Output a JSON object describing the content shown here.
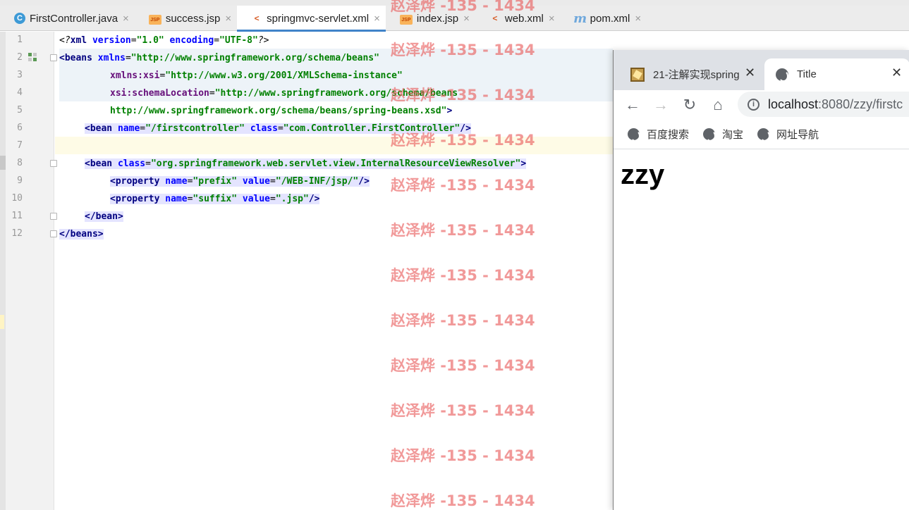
{
  "editor_tabs": [
    {
      "label": "FirstController.java",
      "icon": "java-class-icon",
      "icon_text": "C"
    },
    {
      "label": "success.jsp",
      "icon": "jsp-file-icon",
      "icon_text": "JSP"
    },
    {
      "label": "springmvc-servlet.xml",
      "icon": "xml-file-icon",
      "icon_text": "<"
    },
    {
      "label": "index.jsp",
      "icon": "jsp-file-icon",
      "icon_text": "JSP"
    },
    {
      "label": "web.xml",
      "icon": "xml-file-icon",
      "icon_text": "<"
    },
    {
      "label": "pom.xml",
      "icon": "maven-icon",
      "icon_text": "m"
    }
  ],
  "tab_close_glyph": "×",
  "line_numbers": [
    "1",
    "2",
    "3",
    "4",
    "5",
    "6",
    "7",
    "8",
    "9",
    "10",
    "11",
    "12"
  ],
  "code": {
    "l1": {
      "open": "<?",
      "name": "xml",
      "a1": " version",
      "eq1": "=",
      "v1": "\"1.0\"",
      "a2": " encoding",
      "eq2": "=",
      "v2": "\"UTF-8\"",
      "close": "?>"
    },
    "l2": {
      "tag": "<beans",
      "attr": " xmlns",
      "eq": "=",
      "val": "\"http://www.springframework.org/schema/beans\""
    },
    "l3": {
      "ns": "xmlns:xsi",
      "eq": "=",
      "val": "\"http://www.w3.org/2001/XMLSchema-instance\""
    },
    "l4": {
      "ns": "xsi:schemaLocation",
      "eq": "=",
      "val": "\"http://www.springframework.org/schema/beans"
    },
    "l5": {
      "val": "http://www.springframework.org/schema/beans/spring-beans.xsd\"",
      "close": ">"
    },
    "l6": {
      "tag": "<bean",
      "a1": " name",
      "eq1": "=",
      "v1": "\"/firstcontroller\"",
      "a2": " class",
      "eq2": "=",
      "v2": "\"com.Controller.FirstController\"",
      "close": "/>"
    },
    "l8": {
      "tag": "<bean",
      "a1": " class",
      "eq1": "=",
      "v1": "\"org.springframework.web.servlet.view.InternalResourceViewResolver\"",
      "close": ">"
    },
    "l9": {
      "tag": "<property",
      "a1": " name",
      "eq1": "=",
      "v1": "\"prefix\"",
      "a2": " value",
      "eq2": "=",
      "v2": "\"/WEB-INF/jsp/\"",
      "close": "/>"
    },
    "l10": {
      "tag": "<property",
      "a1": " name",
      "eq1": "=",
      "v1": "\"suffix\"",
      "a2": " value",
      "eq2": "=",
      "v2": "\".jsp\"",
      "close": "/>"
    },
    "l11": {
      "tag": "</bean>"
    },
    "l12": {
      "tag": "</beans>"
    }
  },
  "browser": {
    "tab1_title": "21-注解实现spring",
    "tab2_title": "Title",
    "close_glyph": "✕",
    "back_glyph": "←",
    "forward_glyph": "→",
    "reload_glyph": "↻",
    "home_glyph": "⌂",
    "info_glyph": "i",
    "url_host": "localhost",
    "url_path": ":8080/zzy/firstc",
    "bookmarks": [
      "百度搜索",
      "淘宝",
      "网址导航"
    ],
    "page_text": "zzy"
  },
  "watermark": "赵泽烨 -135 - 1434",
  "colors": {
    "tag": "#000080",
    "attribute": "#0000ff",
    "string": "#008000",
    "namespace": "#660e7a",
    "watermark": "#e95a5a",
    "active_tab_underline": "#4083c9"
  }
}
